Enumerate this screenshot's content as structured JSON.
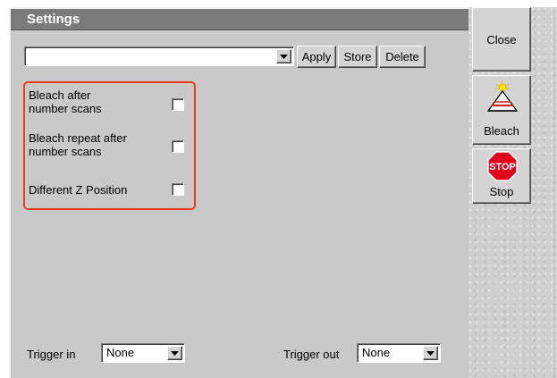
{
  "window": {
    "title": "Settings"
  },
  "toolbar": {
    "preset_value": "",
    "apply_label": "Apply",
    "store_label": "Store",
    "delete_label": "Delete"
  },
  "options": {
    "bleach_after_label": "Bleach after\nnumber scans",
    "bleach_after_checked": false,
    "bleach_repeat_label": "Bleach repeat after\nnumber scans",
    "bleach_repeat_checked": false,
    "different_z_label": "Different Z Position",
    "different_z_checked": false
  },
  "trigger": {
    "in_label": "Trigger in",
    "in_value": "None",
    "out_label": "Trigger out",
    "out_value": "None"
  },
  "side": {
    "close_label": "Close",
    "bleach_label": "Bleach",
    "stop_label": "Stop",
    "stop_sign_text": "STOP"
  },
  "colors": {
    "highlight_border": "#f03c1e",
    "stop_red": "#e0001a",
    "title_bar": "#7a7a7a"
  }
}
